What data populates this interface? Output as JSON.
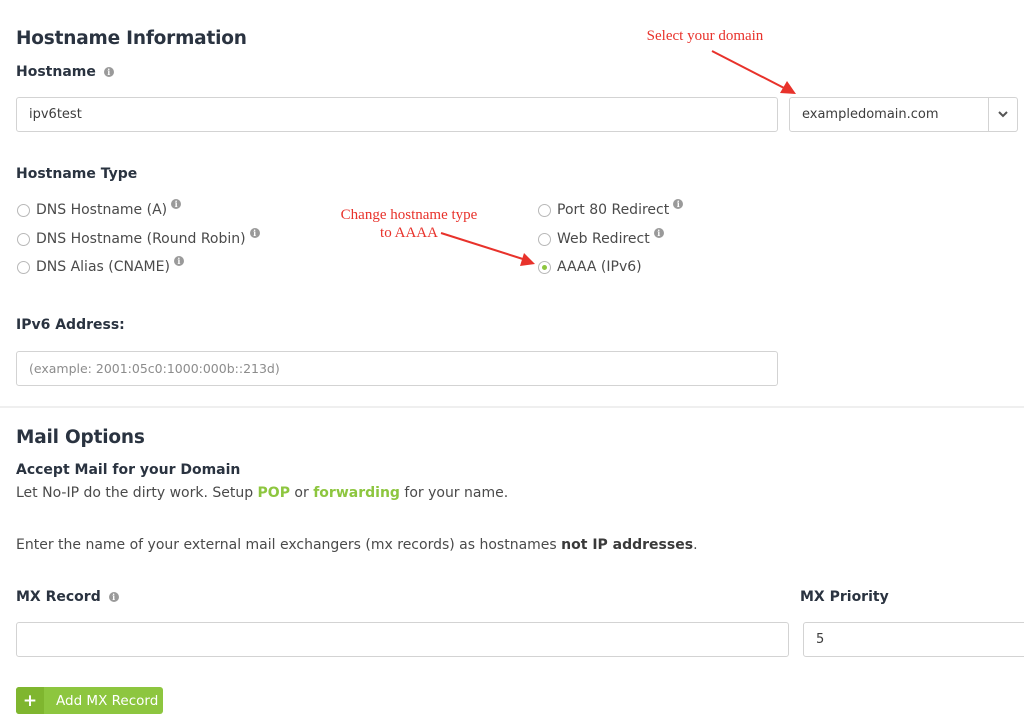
{
  "hostname_section": {
    "title": "Hostname Information",
    "hostname_label": "Hostname",
    "hostname_value": "ipv6test",
    "domain_selected": "exampledomain.com"
  },
  "hostname_type": {
    "label": "Hostname Type",
    "options": [
      {
        "label": "DNS Hostname (A)",
        "checked": false,
        "has_info": true
      },
      {
        "label": "DNS Hostname (Round Robin)",
        "checked": false,
        "has_info": true
      },
      {
        "label": "DNS Alias (CNAME)",
        "checked": false,
        "has_info": true
      },
      {
        "label": "Port 80 Redirect",
        "checked": false,
        "has_info": true
      },
      {
        "label": "Web Redirect",
        "checked": false,
        "has_info": true
      },
      {
        "label": "AAAA (IPv6)",
        "checked": true,
        "has_info": false
      }
    ]
  },
  "ipv6": {
    "label": "IPv6 Address:",
    "placeholder": "(example: 2001:05c0:1000:000b::213d)",
    "value": ""
  },
  "mail": {
    "title": "Mail Options",
    "subtitle": "Accept Mail for your Domain",
    "desc_prefix": "Let No-IP do the dirty work. Setup ",
    "link_pop": "POP",
    "desc_mid": " or ",
    "link_forwarding": "forwarding",
    "desc_suffix": " for your name.",
    "mx_note_prefix": "Enter the name of your external mail exchangers (mx records) as hostnames ",
    "mx_note_bold": "not IP addresses",
    "mx_note_suffix": ".",
    "mx_record_label": "MX Record",
    "mx_record_value": "",
    "mx_priority_label": "MX Priority",
    "mx_priority_value": "5",
    "add_button_label": "Add MX Record"
  },
  "annotations": {
    "select_domain": "Select your domain",
    "change_type_line1": "Change hostname type",
    "change_type_line2": "to AAAA"
  },
  "icons": {
    "info": "i",
    "plus": "+"
  },
  "colors": {
    "accent_green": "#8dc63f",
    "annotation_red": "#e8322b",
    "heading": "#2a3340"
  }
}
